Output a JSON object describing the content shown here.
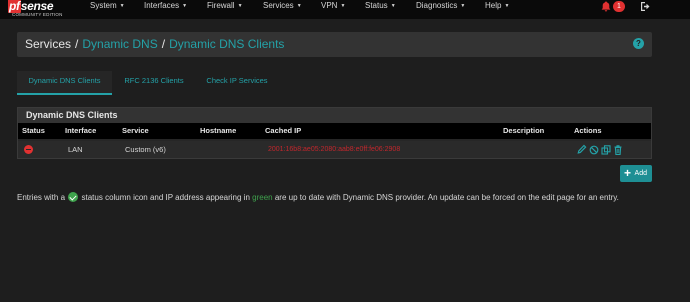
{
  "brand": {
    "logo_pf": "pf",
    "logo_sense": "sense",
    "logo_edition": "COMMUNITY EDITION"
  },
  "nav": {
    "items": [
      {
        "label": "System"
      },
      {
        "label": "Interfaces"
      },
      {
        "label": "Firewall"
      },
      {
        "label": "Services"
      },
      {
        "label": "VPN"
      },
      {
        "label": "Status"
      },
      {
        "label": "Diagnostics"
      },
      {
        "label": "Help"
      }
    ],
    "notification_count": "1"
  },
  "breadcrumb": {
    "base": "Services",
    "sep": "/",
    "item1": "Dynamic DNS",
    "item2": "Dynamic DNS Clients"
  },
  "tabs": [
    {
      "label": "Dynamic DNS Clients",
      "active": true
    },
    {
      "label": "RFC 2136 Clients",
      "active": false
    },
    {
      "label": "Check IP Services",
      "active": false
    }
  ],
  "panel": {
    "title": "Dynamic DNS Clients",
    "columns": [
      "Status",
      "Interface",
      "Service",
      "Hostname",
      "Cached IP",
      "Description",
      "Actions"
    ],
    "rows": [
      {
        "status": "error",
        "interface": "LAN",
        "service": "Custom (v6)",
        "hostname": "",
        "cached_ip": "2001:16b8:ae05:2080:aab8:e0ff:fe06:2908",
        "description": ""
      }
    ]
  },
  "add_button": {
    "label": "Add"
  },
  "info": {
    "part1": "Entries with a",
    "part2": "status column icon and IP address appearing in",
    "green_word": "green",
    "part3": "are up to date with Dynamic DNS provider. An update can be forced on the edit page for an entry."
  },
  "colors": {
    "accent": "#24a2a8",
    "error": "#e13131",
    "ok": "#3fa34d"
  }
}
